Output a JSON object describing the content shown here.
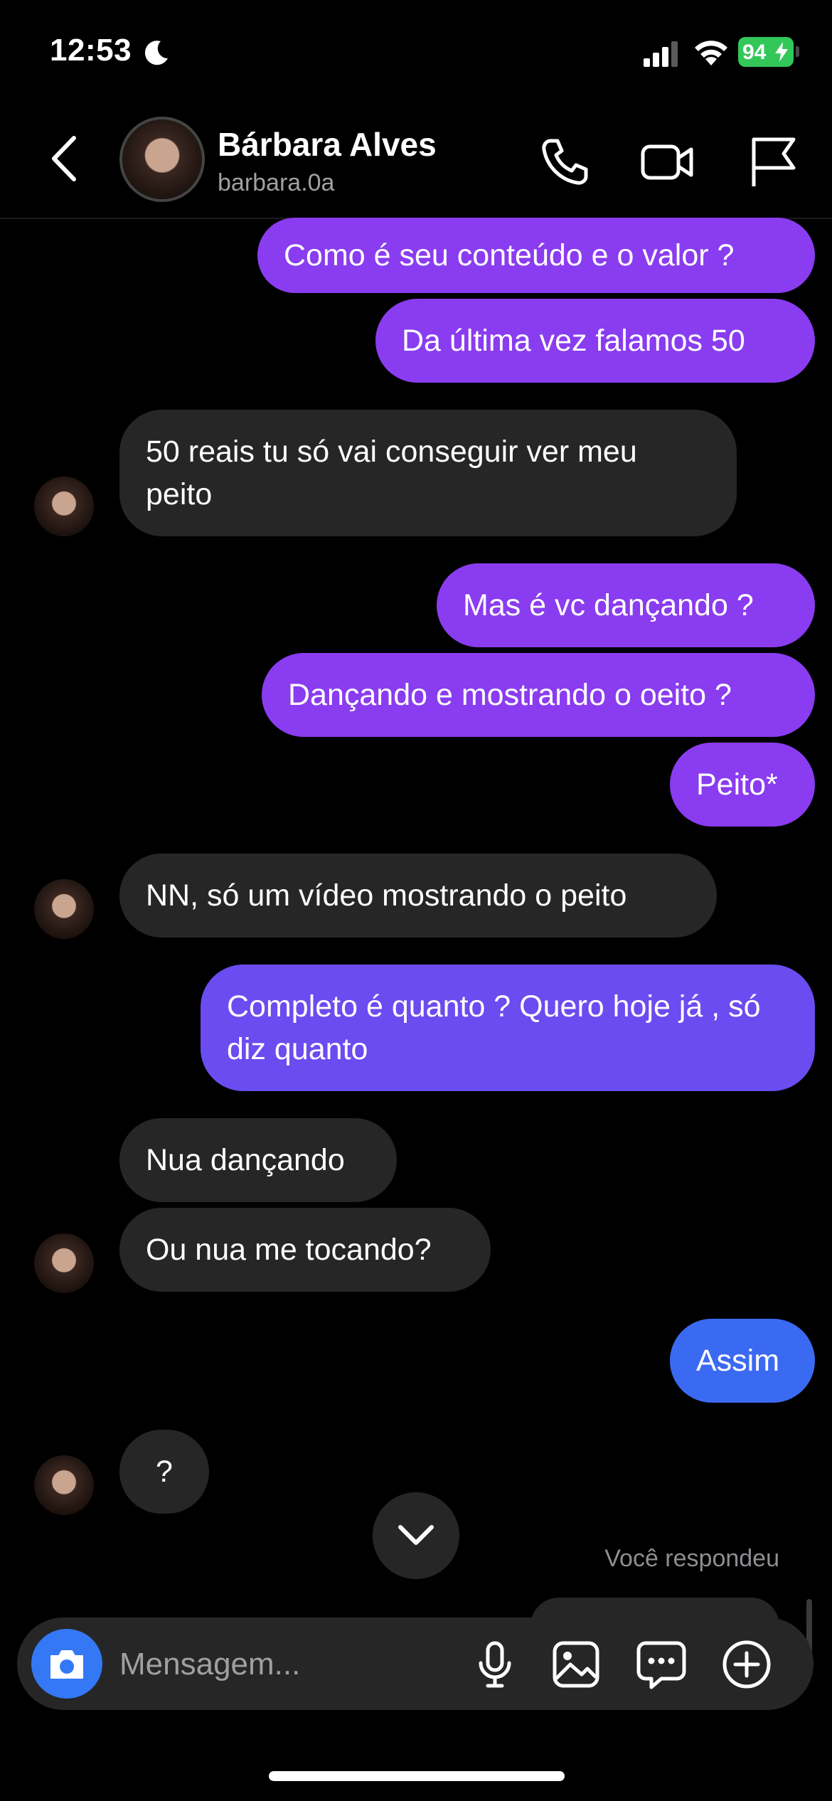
{
  "status_bar": {
    "time": "12:53",
    "battery": "94"
  },
  "header": {
    "contact_name": "Bárbara Alves",
    "username": "barbara.0a"
  },
  "messages": [
    {
      "text": "Como é seu conteúdo e o valor ?",
      "side": "out"
    },
    {
      "text": "Da última vez falamos 50",
      "side": "out"
    },
    {
      "text": "50 reais tu só vai conseguir ver meu peito",
      "side": "in"
    },
    {
      "text": "Mas é vc dançando ?",
      "side": "out"
    },
    {
      "text": "Dançando e mostrando o oeito ?",
      "side": "out"
    },
    {
      "text": "Peito*",
      "side": "out"
    },
    {
      "text": "NN, só um vídeo mostrando o peito",
      "side": "in"
    },
    {
      "text": "Completo é quanto ? Quero hoje já , só diz quanto",
      "side": "out"
    },
    {
      "text": "Nua dançando",
      "side": "in"
    },
    {
      "text": "Ou nua me tocando?",
      "side": "in"
    },
    {
      "text": "Assim",
      "side": "out"
    },
    {
      "text": "?",
      "side": "in"
    }
  ],
  "reply_note": "Você respondeu",
  "composer": {
    "placeholder": "Mensagem..."
  },
  "colors": {
    "outgoing_purple": "#8a3cf0",
    "outgoing_indigo": "#6a4cf0",
    "outgoing_blue": "#3b6af2",
    "incoming": "#262626",
    "camera_button": "#3478f6",
    "battery": "#33c759"
  }
}
